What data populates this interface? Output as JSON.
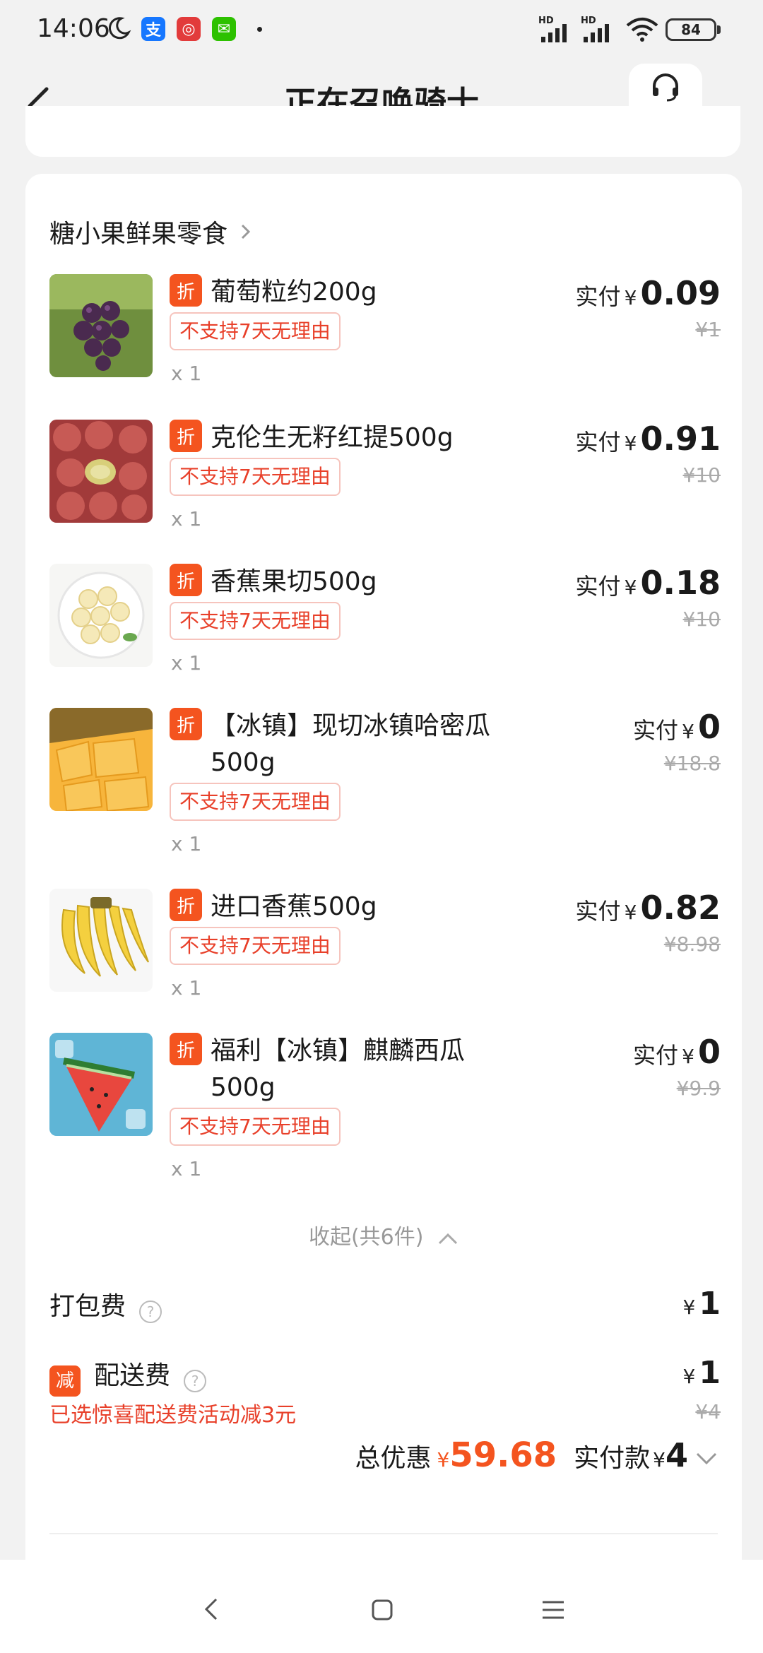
{
  "status_bar": {
    "time": "14:06",
    "battery": "84",
    "network_label": "HD",
    "app_icons": [
      "alipay-icon",
      "app-red-icon",
      "wechat-icon"
    ]
  },
  "header": {
    "title": "正在召唤骑士",
    "service_label": "客服"
  },
  "shop": {
    "name": "糖小果鲜果零食"
  },
  "labels": {
    "discount_badge": "折",
    "paid_label": "实付",
    "yen": "¥",
    "policy_tag": "不支持7天无理由"
  },
  "items": [
    {
      "name": "葡萄粒约200g",
      "qty": "x 1",
      "paid": "0.09",
      "original": "¥1",
      "thumb": "grape"
    },
    {
      "name": "克伦生无籽红提500g",
      "qty": "x 1",
      "paid": "0.91",
      "original": "¥10",
      "thumb": "red-grape"
    },
    {
      "name": "香蕉果切500g",
      "qty": "x 1",
      "paid": "0.18",
      "original": "¥10",
      "thumb": "banana-slices"
    },
    {
      "name": "【冰镇】现切冰镇哈密瓜500g",
      "qty": "x 1",
      "paid": "0",
      "original": "¥18.8",
      "thumb": "melon"
    },
    {
      "name": "进口香蕉500g",
      "qty": "x 1",
      "paid": "0.82",
      "original": "¥8.98",
      "thumb": "banana"
    },
    {
      "name": "福利【冰镇】麒麟西瓜500g",
      "qty": "x 1",
      "paid": "0",
      "original": "¥9.9",
      "thumb": "watermelon"
    }
  ],
  "collapse_label": "收起(共6件)",
  "packing_fee": {
    "label": "打包费",
    "amount": "1"
  },
  "delivery_fee": {
    "badge": "减",
    "label": "配送费",
    "amount": "1",
    "original": "¥4",
    "promo": "已选惊喜配送费活动减3元"
  },
  "totals": {
    "discount_label": "总优惠",
    "discount_value": "59.68",
    "paid_label": "实付款",
    "paid_value": "4"
  },
  "colors": {
    "accent": "#f4541f",
    "tag_red": "#e8402a"
  }
}
